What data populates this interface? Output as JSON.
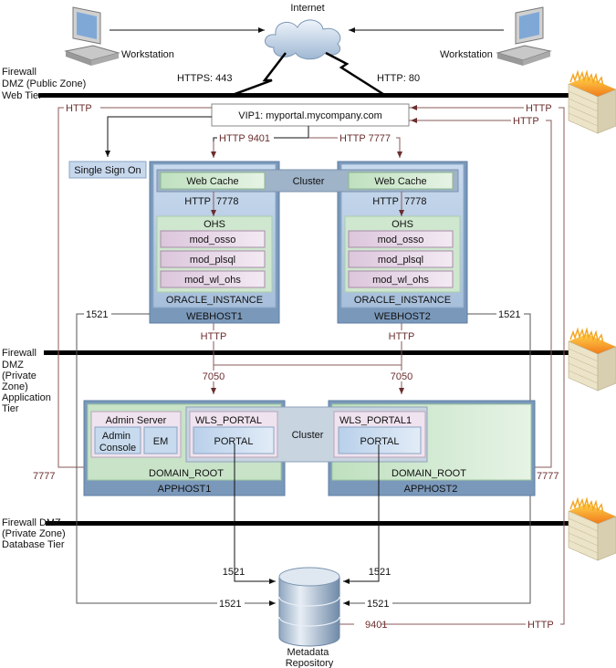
{
  "internet": {
    "label": "Internet"
  },
  "workstations": [
    {
      "label": "Workstation"
    },
    {
      "label": "Workstation"
    }
  ],
  "links": {
    "https": "HTTPS: 443",
    "http80": "HTTP: 80"
  },
  "zones": {
    "web": [
      "Firewall",
      "DMZ (Public Zone)",
      "Web Tier"
    ],
    "app": [
      "Firewall",
      "DMZ",
      "(Private",
      "Zone)",
      "Application",
      "Tier"
    ],
    "db": [
      "Firewall DMZ",
      "(Private Zone)",
      "Database Tier"
    ]
  },
  "vip": {
    "label": "VIP1: myportal.mycompany.com"
  },
  "sso": {
    "label": "Single Sign On"
  },
  "ports": {
    "http": "HTTP",
    "http9401": "HTTP 9401",
    "http7777": "HTTP 7777",
    "http7778": "HTTP",
    "p7778": "7778",
    "p1521": "1521",
    "p7050": "7050",
    "p7777": "7777",
    "p9401": "9401"
  },
  "webhosts": [
    {
      "name": "WEBHOST1",
      "instance": "ORACLE_INSTANCE",
      "webcache": "Web Cache",
      "ohs": "OHS",
      "modules": [
        "mod_osso",
        "mod_plsql",
        "mod_wl_ohs"
      ]
    },
    {
      "name": "WEBHOST2",
      "instance": "ORACLE_INSTANCE",
      "webcache": "Web Cache",
      "ohs": "OHS",
      "modules": [
        "mod_osso",
        "mod_plsql",
        "mod_wl_ohs"
      ]
    }
  ],
  "cluster": {
    "label": "Cluster"
  },
  "apphosts": [
    {
      "name": "APPHOST1",
      "domain": "DOMAIN_ROOT",
      "admin_server": "Admin Server",
      "admin_console": [
        "Admin",
        "Console"
      ],
      "em": "EM",
      "wls": "WLS_PORTAL",
      "portal": "PORTAL"
    },
    {
      "name": "APPHOST2",
      "domain": "DOMAIN_ROOT",
      "wls": "WLS_PORTAL1",
      "portal": "PORTAL"
    }
  ],
  "repository": {
    "label": [
      "Metadata",
      "Repository"
    ]
  }
}
